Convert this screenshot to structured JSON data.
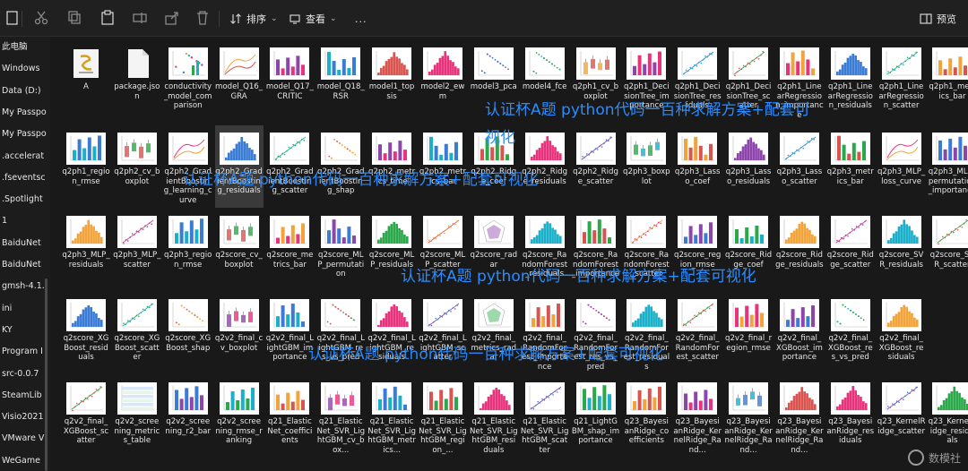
{
  "toolbar": {
    "sort_label": "排序",
    "view_label": "查看",
    "more_label": "...",
    "preview_label": "预览"
  },
  "sidebar": {
    "items": [
      "此电脑",
      "Windows",
      "Data (D:)",
      "My Passpo",
      "My Passpo",
      ".accelerat",
      ".fseventsc",
      ".Spotlight",
      "1",
      "BaiduNet",
      "BaiduNet",
      "gmsh-4.1.",
      "ini",
      "KY",
      "Program I",
      "src-0.0.7",
      "SteamLib",
      "Visio2021",
      "VMware V",
      "WeGame"
    ]
  },
  "watermark": {
    "line1": "认证杯A题 python代码一百种求解方案+配套可",
    "line1b": "视化",
    "line2": "认证杯A题 python代码一百种求解方案+配套可视化",
    "line3": "认证杯A题 python代码一百种求解方案+配套可视化",
    "line4": "认证杯A题 python代码一百种求解方案+配套可视化"
  },
  "rows": [
    [
      {
        "name": "A",
        "kind": "script"
      },
      {
        "name": "package.json",
        "kind": "doc"
      },
      {
        "name": "conductivity_model_comparison",
        "kind": "mixed"
      },
      {
        "name": "model_Q16_GRA",
        "kind": "lines"
      },
      {
        "name": "model_Q17_CRITIC",
        "kind": "bars"
      },
      {
        "name": "model_Q18_RSR",
        "kind": "bars"
      },
      {
        "name": "model1_topsis",
        "kind": "hist"
      },
      {
        "name": "model2_ewm",
        "kind": "hist"
      },
      {
        "name": "model3_pca",
        "kind": "scatter"
      },
      {
        "name": "model4_fce",
        "kind": "scatter"
      },
      {
        "name": "q2ph1_cv_boxplot",
        "kind": "box"
      },
      {
        "name": "q2ph1_DecisionTree_importance",
        "kind": "bars"
      },
      {
        "name": "q2ph1_DecisionTree_residuals",
        "kind": "line"
      },
      {
        "name": "q2ph1_DecisionTree_scatter",
        "kind": "line"
      },
      {
        "name": "q2ph1_LinearRegression_importance",
        "kind": "bars"
      },
      {
        "name": "q2ph1_LinearRegression_residuals",
        "kind": "hist"
      },
      {
        "name": "q2ph1_LinearRegression_scatter",
        "kind": "line"
      },
      {
        "name": "q2ph1_metrics_bar",
        "kind": "bars"
      }
    ],
    [
      {
        "name": "q2ph1_region_rmse",
        "kind": "bars"
      },
      {
        "name": "q2ph2_cv_boxplot",
        "kind": "box"
      },
      {
        "name": "q2ph2_GradientBoosting_learning_curve",
        "kind": "lines"
      },
      {
        "name": "q2ph2_GradientBoosting_residuals",
        "kind": "hist",
        "sel": true
      },
      {
        "name": "q2ph2_GradientBoosting_scatter",
        "kind": "line"
      },
      {
        "name": "q2ph2_GradientBoosting_shap",
        "kind": "scatter"
      },
      {
        "name": "q2ph2_metrics_time",
        "kind": "bars"
      },
      {
        "name": "q2ph2_metrics_bar",
        "kind": "bars"
      },
      {
        "name": "q2ph2_Ridge_coef",
        "kind": "bars"
      },
      {
        "name": "q2ph2_Ridge_residuals",
        "kind": "hist"
      },
      {
        "name": "q2ph2_Ridge_scatter",
        "kind": "line"
      },
      {
        "name": "q2ph3_boxplot",
        "kind": "box"
      },
      {
        "name": "q2ph3_Lasso_coef",
        "kind": "bars"
      },
      {
        "name": "q2ph3_Lasso_residuals",
        "kind": "hist"
      },
      {
        "name": "q2ph3_Lasso_scatter",
        "kind": "line"
      },
      {
        "name": "q2ph3_metrics_bar",
        "kind": "bars"
      },
      {
        "name": "q2ph3_MLP_loss_curve",
        "kind": "lines"
      },
      {
        "name": "q2ph3_MLP_permutation_importance",
        "kind": "bars"
      }
    ],
    [
      {
        "name": "q2ph3_MLP_residuals",
        "kind": "hist"
      },
      {
        "name": "q2ph3_MLP_scatter",
        "kind": "line"
      },
      {
        "name": "q2ph3_region_rmse",
        "kind": "bars"
      },
      {
        "name": "q2score_cv_boxplot",
        "kind": "box"
      },
      {
        "name": "q2score_metrics_bar",
        "kind": "bars"
      },
      {
        "name": "q2score_MLP_permutation",
        "kind": "bars"
      },
      {
        "name": "q2score_MLP_residuals",
        "kind": "hist"
      },
      {
        "name": "q2score_MLP_scatter",
        "kind": "line"
      },
      {
        "name": "q2score_radar",
        "kind": "radar"
      },
      {
        "name": "q2score_RandomForest_residuals",
        "kind": "hist"
      },
      {
        "name": "q2score_RandomForest_importance",
        "kind": "bars"
      },
      {
        "name": "q2score_RandomForest_scatter",
        "kind": "line"
      },
      {
        "name": "q2score_region_rmse",
        "kind": "bars"
      },
      {
        "name": "q2score_Ridge_coef",
        "kind": "bars"
      },
      {
        "name": "q2score_Ridge_residuals",
        "kind": "hist"
      },
      {
        "name": "q2score_Ridge_scatter",
        "kind": "line"
      },
      {
        "name": "q2score_SVR_residuals",
        "kind": "hist"
      },
      {
        "name": "q2score_SVR_scatter",
        "kind": "line"
      }
    ],
    [
      {
        "name": "q2score_XGBoost_residuals",
        "kind": "hist"
      },
      {
        "name": "q2score_XGBoost_scatter",
        "kind": "line"
      },
      {
        "name": "q2score_XGBoost_shap",
        "kind": "scatter"
      },
      {
        "name": "q2v2_final_cv_boxplot",
        "kind": "box"
      },
      {
        "name": "q2v2_final_LightGBM_importance",
        "kind": "bars"
      },
      {
        "name": "q2v2_final_LightGBM_res_vs_pred",
        "kind": "scatter"
      },
      {
        "name": "q2v2_final_LightGBM_residuals",
        "kind": "hist"
      },
      {
        "name": "q2v2_final_LightGBM_scatter",
        "kind": "line"
      },
      {
        "name": "q2v2_final_metrics_radar",
        "kind": "radar"
      },
      {
        "name": "q2v2_final_RandomForest_importance",
        "kind": "bars"
      },
      {
        "name": "q2v2_final_RandomForest_res_vs_pred",
        "kind": "scatter"
      },
      {
        "name": "q2v2_final_RandomForest_residuals",
        "kind": "hist"
      },
      {
        "name": "q2v2_final_RandomForest_scatter",
        "kind": "line"
      },
      {
        "name": "q2v2_final_region_rmse",
        "kind": "bars"
      },
      {
        "name": "q2v2_final_XGBoost_importance",
        "kind": "bars"
      },
      {
        "name": "q2v2_final_XGBoost_res_vs_pred",
        "kind": "scatter"
      },
      {
        "name": "q2v2_final_XGBoost_residuals",
        "kind": "hist"
      }
    ],
    [
      {
        "name": "q2v2_final_XGBoost_scatter",
        "kind": "line"
      },
      {
        "name": "q2v2_screening_metrics_table",
        "kind": "table"
      },
      {
        "name": "q2v2_screening_r2_bar",
        "kind": "bars"
      },
      {
        "name": "q2v2_screening_rmse_ranking",
        "kind": "bars"
      },
      {
        "name": "q21_ElasticNet_coefficients",
        "kind": "bars"
      },
      {
        "name": "q21_ElasticNet_SVR_LightGBM_cv_box...",
        "kind": "box"
      },
      {
        "name": "q21_ElasticNet_SVR_LightGBM_metrics...",
        "kind": "bars"
      },
      {
        "name": "q21_ElasticNet_SVR_LightGBM_region_...",
        "kind": "bars"
      },
      {
        "name": "q21_ElasticNet_SVR_LightGBM_residuals",
        "kind": "hist"
      },
      {
        "name": "q21_ElasticNet_SVR_LightGBM_scatter",
        "kind": "line"
      },
      {
        "name": "q21_LightGBM_shap_importance",
        "kind": "bars"
      },
      {
        "name": "q23_BayesianRidge_coefficients",
        "kind": "bars"
      },
      {
        "name": "q23_BayesianRidge_KernelRidge_Rand...",
        "kind": "bars"
      },
      {
        "name": "q23_BayesianRidge_KernelRidge_Rand...",
        "kind": "box"
      },
      {
        "name": "q23_BayesianRidge_KernelRidge_Rand...",
        "kind": "hist"
      },
      {
        "name": "q23_BayesianRidge_residuals",
        "kind": "hist"
      },
      {
        "name": "q23_KernelRidge_scatter",
        "kind": "line"
      },
      {
        "name": "q23_KernelRidge_residuals",
        "kind": "hist"
      }
    ]
  ],
  "brand": "数模社"
}
